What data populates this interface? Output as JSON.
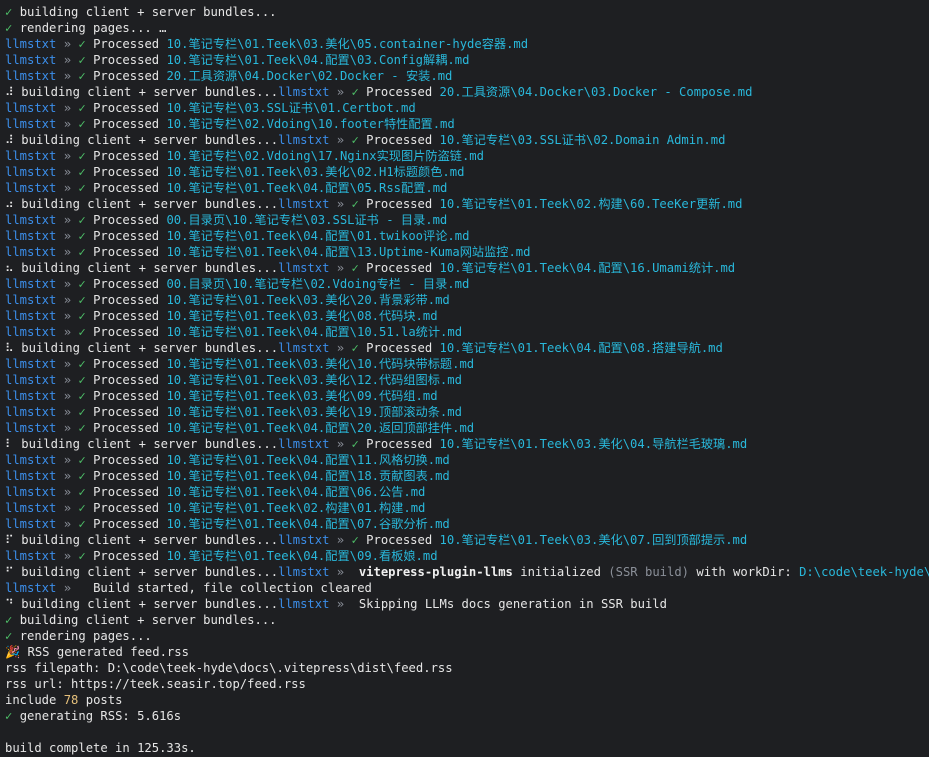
{
  "lines": [
    [
      [
        "g",
        "✓ "
      ],
      [
        "w",
        "building client + server bundles..."
      ]
    ],
    [
      [
        "g",
        "✓ "
      ],
      [
        "w",
        "rendering pages... …"
      ]
    ],
    [
      [
        "b",
        "llmstxt"
      ],
      [
        "gr",
        " » "
      ],
      [
        "g",
        "✓ "
      ],
      [
        "w",
        "Processed "
      ],
      [
        "c",
        "10.笔记专栏\\01.Teek\\03.美化\\05.container-hyde容器.md"
      ]
    ],
    [
      [
        "b",
        "llmstxt"
      ],
      [
        "gr",
        " » "
      ],
      [
        "g",
        "✓ "
      ],
      [
        "w",
        "Processed "
      ],
      [
        "c",
        "10.笔记专栏\\01.Teek\\04.配置\\03.Config解耦.md"
      ]
    ],
    [
      [
        "b",
        "llmstxt"
      ],
      [
        "gr",
        " » "
      ],
      [
        "g",
        "✓ "
      ],
      [
        "w",
        "Processed "
      ],
      [
        "c",
        "20.工具资源\\04.Docker\\02.Docker - 安装.md"
      ]
    ],
    [
      [
        "w",
        "⠼ building client + server bundles..."
      ],
      [
        "b",
        "llmstxt"
      ],
      [
        "gr",
        " » "
      ],
      [
        "g",
        "✓ "
      ],
      [
        "w",
        "Processed "
      ],
      [
        "c",
        "20.工具资源\\04.Docker\\03.Docker - Compose.md"
      ]
    ],
    [
      [
        "b",
        "llmstxt"
      ],
      [
        "gr",
        " » "
      ],
      [
        "g",
        "✓ "
      ],
      [
        "w",
        "Processed "
      ],
      [
        "c",
        "10.笔记专栏\\03.SSL证书\\01.Certbot.md"
      ]
    ],
    [
      [
        "b",
        "llmstxt"
      ],
      [
        "gr",
        " » "
      ],
      [
        "g",
        "✓ "
      ],
      [
        "w",
        "Processed "
      ],
      [
        "c",
        "10.笔记专栏\\02.Vdoing\\10.footer特性配置.md"
      ]
    ],
    [
      [
        "w",
        "⠼ building client + server bundles..."
      ],
      [
        "b",
        "llmstxt"
      ],
      [
        "gr",
        " » "
      ],
      [
        "g",
        "✓ "
      ],
      [
        "w",
        "Processed "
      ],
      [
        "c",
        "10.笔记专栏\\03.SSL证书\\02.Domain Admin.md"
      ]
    ],
    [
      [
        "b",
        "llmstxt"
      ],
      [
        "gr",
        " » "
      ],
      [
        "g",
        "✓ "
      ],
      [
        "w",
        "Processed "
      ],
      [
        "c",
        "10.笔记专栏\\02.Vdoing\\17.Nginx实现图片防盗链.md"
      ]
    ],
    [
      [
        "b",
        "llmstxt"
      ],
      [
        "gr",
        " » "
      ],
      [
        "g",
        "✓ "
      ],
      [
        "w",
        "Processed "
      ],
      [
        "c",
        "10.笔记专栏\\01.Teek\\03.美化\\02.H1标题颜色.md"
      ]
    ],
    [
      [
        "b",
        "llmstxt"
      ],
      [
        "gr",
        " » "
      ],
      [
        "g",
        "✓ "
      ],
      [
        "w",
        "Processed "
      ],
      [
        "c",
        "10.笔记专栏\\01.Teek\\04.配置\\05.Rss配置.md"
      ]
    ],
    [
      [
        "w",
        "⠴ building client + server bundles..."
      ],
      [
        "b",
        "llmstxt"
      ],
      [
        "gr",
        " » "
      ],
      [
        "g",
        "✓ "
      ],
      [
        "w",
        "Processed "
      ],
      [
        "c",
        "10.笔记专栏\\01.Teek\\02.构建\\60.TeeKer更新.md"
      ]
    ],
    [
      [
        "b",
        "llmstxt"
      ],
      [
        "gr",
        " » "
      ],
      [
        "g",
        "✓ "
      ],
      [
        "w",
        "Processed "
      ],
      [
        "c",
        "00.目录页\\10.笔记专栏\\03.SSL证书 - 目录.md"
      ]
    ],
    [
      [
        "b",
        "llmstxt"
      ],
      [
        "gr",
        " » "
      ],
      [
        "g",
        "✓ "
      ],
      [
        "w",
        "Processed "
      ],
      [
        "c",
        "10.笔记专栏\\01.Teek\\04.配置\\01.twikoo评论.md"
      ]
    ],
    [
      [
        "b",
        "llmstxt"
      ],
      [
        "gr",
        " » "
      ],
      [
        "g",
        "✓ "
      ],
      [
        "w",
        "Processed "
      ],
      [
        "c",
        "10.笔记专栏\\01.Teek\\04.配置\\13.Uptime-Kuma网站监控.md"
      ]
    ],
    [
      [
        "w",
        "⠦ building client + server bundles..."
      ],
      [
        "b",
        "llmstxt"
      ],
      [
        "gr",
        " » "
      ],
      [
        "g",
        "✓ "
      ],
      [
        "w",
        "Processed "
      ],
      [
        "c",
        "10.笔记专栏\\01.Teek\\04.配置\\16.Umami统计.md"
      ]
    ],
    [
      [
        "b",
        "llmstxt"
      ],
      [
        "gr",
        " » "
      ],
      [
        "g",
        "✓ "
      ],
      [
        "w",
        "Processed "
      ],
      [
        "c",
        "00.目录页\\10.笔记专栏\\02.Vdoing专栏 - 目录.md"
      ]
    ],
    [
      [
        "b",
        "llmstxt"
      ],
      [
        "gr",
        " » "
      ],
      [
        "g",
        "✓ "
      ],
      [
        "w",
        "Processed "
      ],
      [
        "c",
        "10.笔记专栏\\01.Teek\\03.美化\\20.背景彩带.md"
      ]
    ],
    [
      [
        "b",
        "llmstxt"
      ],
      [
        "gr",
        " » "
      ],
      [
        "g",
        "✓ "
      ],
      [
        "w",
        "Processed "
      ],
      [
        "c",
        "10.笔记专栏\\01.Teek\\03.美化\\08.代码块.md"
      ]
    ],
    [
      [
        "b",
        "llmstxt"
      ],
      [
        "gr",
        " » "
      ],
      [
        "g",
        "✓ "
      ],
      [
        "w",
        "Processed "
      ],
      [
        "c",
        "10.笔记专栏\\01.Teek\\04.配置\\10.51.la统计.md"
      ]
    ],
    [
      [
        "w",
        "⠧ building client + server bundles..."
      ],
      [
        "b",
        "llmstxt"
      ],
      [
        "gr",
        " » "
      ],
      [
        "g",
        "✓ "
      ],
      [
        "w",
        "Processed "
      ],
      [
        "c",
        "10.笔记专栏\\01.Teek\\04.配置\\08.搭建导航.md"
      ]
    ],
    [
      [
        "b",
        "llmstxt"
      ],
      [
        "gr",
        " » "
      ],
      [
        "g",
        "✓ "
      ],
      [
        "w",
        "Processed "
      ],
      [
        "c",
        "10.笔记专栏\\01.Teek\\03.美化\\10.代码块带标题.md"
      ]
    ],
    [
      [
        "b",
        "llmstxt"
      ],
      [
        "gr",
        " » "
      ],
      [
        "g",
        "✓ "
      ],
      [
        "w",
        "Processed "
      ],
      [
        "c",
        "10.笔记专栏\\01.Teek\\03.美化\\12.代码组图标.md"
      ]
    ],
    [
      [
        "b",
        "llmstxt"
      ],
      [
        "gr",
        " » "
      ],
      [
        "g",
        "✓ "
      ],
      [
        "w",
        "Processed "
      ],
      [
        "c",
        "10.笔记专栏\\01.Teek\\03.美化\\09.代码组.md"
      ]
    ],
    [
      [
        "b",
        "llmstxt"
      ],
      [
        "gr",
        " » "
      ],
      [
        "g",
        "✓ "
      ],
      [
        "w",
        "Processed "
      ],
      [
        "c",
        "10.笔记专栏\\01.Teek\\03.美化\\19.顶部滚动条.md"
      ]
    ],
    [
      [
        "b",
        "llmstxt"
      ],
      [
        "gr",
        " » "
      ],
      [
        "g",
        "✓ "
      ],
      [
        "w",
        "Processed "
      ],
      [
        "c",
        "10.笔记专栏\\01.Teek\\04.配置\\20.返回顶部挂件.md"
      ]
    ],
    [
      [
        "w",
        "⠇ building client + server bundles..."
      ],
      [
        "b",
        "llmstxt"
      ],
      [
        "gr",
        " » "
      ],
      [
        "g",
        "✓ "
      ],
      [
        "w",
        "Processed "
      ],
      [
        "c",
        "10.笔记专栏\\01.Teek\\03.美化\\04.导航栏毛玻璃.md"
      ]
    ],
    [
      [
        "b",
        "llmstxt"
      ],
      [
        "gr",
        " » "
      ],
      [
        "g",
        "✓ "
      ],
      [
        "w",
        "Processed "
      ],
      [
        "c",
        "10.笔记专栏\\01.Teek\\04.配置\\11.风格切换.md"
      ]
    ],
    [
      [
        "b",
        "llmstxt"
      ],
      [
        "gr",
        " » "
      ],
      [
        "g",
        "✓ "
      ],
      [
        "w",
        "Processed "
      ],
      [
        "c",
        "10.笔记专栏\\01.Teek\\04.配置\\18.贡献图表.md"
      ]
    ],
    [
      [
        "b",
        "llmstxt"
      ],
      [
        "gr",
        " » "
      ],
      [
        "g",
        "✓ "
      ],
      [
        "w",
        "Processed "
      ],
      [
        "c",
        "10.笔记专栏\\01.Teek\\04.配置\\06.公告.md"
      ]
    ],
    [
      [
        "b",
        "llmstxt"
      ],
      [
        "gr",
        " » "
      ],
      [
        "g",
        "✓ "
      ],
      [
        "w",
        "Processed "
      ],
      [
        "c",
        "10.笔记专栏\\01.Teek\\02.构建\\01.构建.md"
      ]
    ],
    [
      [
        "b",
        "llmstxt"
      ],
      [
        "gr",
        " » "
      ],
      [
        "g",
        "✓ "
      ],
      [
        "w",
        "Processed "
      ],
      [
        "c",
        "10.笔记专栏\\01.Teek\\04.配置\\07.谷歌分析.md"
      ]
    ],
    [
      [
        "w",
        "⠏ building client + server bundles..."
      ],
      [
        "b",
        "llmstxt"
      ],
      [
        "gr",
        " » "
      ],
      [
        "g",
        "✓ "
      ],
      [
        "w",
        "Processed "
      ],
      [
        "c",
        "10.笔记专栏\\01.Teek\\03.美化\\07.回到顶部提示.md"
      ]
    ],
    [
      [
        "b",
        "llmstxt"
      ],
      [
        "gr",
        " » "
      ],
      [
        "g",
        "✓ "
      ],
      [
        "w",
        "Processed "
      ],
      [
        "c",
        "10.笔记专栏\\01.Teek\\04.配置\\09.看板娘.md"
      ]
    ],
    [
      [
        "w",
        "⠋ building client + server bundles..."
      ],
      [
        "b",
        "llmstxt"
      ],
      [
        "gr",
        " »  "
      ],
      [
        "bold",
        "vitepress-plugin-llms"
      ],
      [
        "w",
        " initialized "
      ],
      [
        "gr",
        "(SSR build)"
      ],
      [
        "w",
        " with workDir: "
      ],
      [
        "c",
        "D:\\code\\teek-hyde\\docs"
      ]
    ],
    [
      [
        "b",
        "llmstxt"
      ],
      [
        "gr",
        " »   "
      ],
      [
        "w",
        "Build started, file collection cleared"
      ]
    ],
    [
      [
        "w",
        "⠙ building client + server bundles..."
      ],
      [
        "b",
        "llmstxt"
      ],
      [
        "gr",
        " »  "
      ],
      [
        "w",
        "Skipping LLMs docs generation in SSR build"
      ]
    ],
    [
      [
        "g",
        "✓ "
      ],
      [
        "w",
        "building client + server bundles..."
      ]
    ],
    [
      [
        "g",
        "✓ "
      ],
      [
        "w",
        "rendering pages..."
      ]
    ],
    [
      [
        "w",
        "🎉 RSS generated feed.rss"
      ]
    ],
    [
      [
        "w",
        "rss filepath: D:\\code\\teek-hyde\\docs\\.vitepress\\dist\\feed.rss"
      ]
    ],
    [
      [
        "w",
        "rss url: https://teek.seasir.top/feed.rss"
      ]
    ],
    [
      [
        "w",
        "include "
      ],
      [
        "y",
        "78"
      ],
      [
        "w",
        " posts"
      ]
    ],
    [
      [
        "g",
        "✓ "
      ],
      [
        "w",
        "generating RSS: 5.616s"
      ]
    ],
    [],
    [
      [
        "w",
        "build complete in 125.33s."
      ]
    ]
  ]
}
